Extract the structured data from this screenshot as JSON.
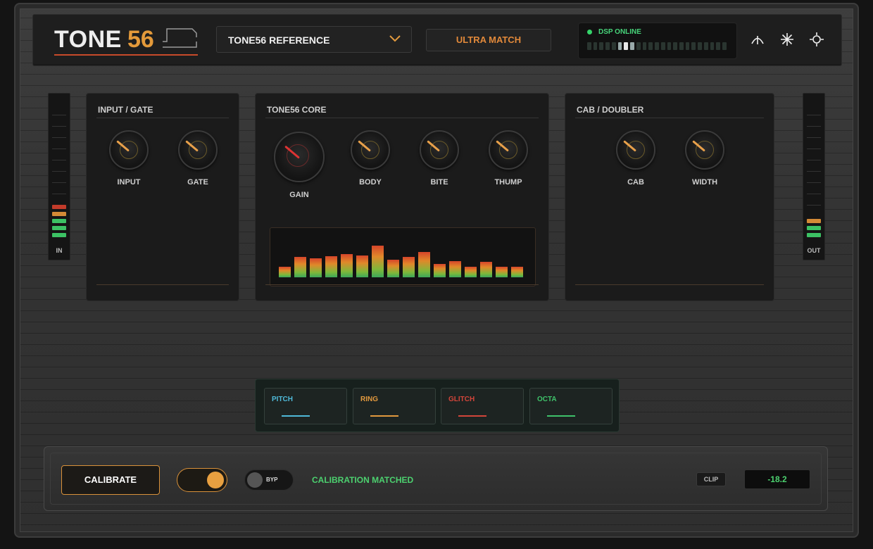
{
  "header": {
    "logo_word": "TONE",
    "logo_number": "56",
    "preset_name": "TONE56 REFERENCE",
    "mode_button": "ULTRA MATCH",
    "dsp_status": "DSP ONLINE",
    "icons": [
      "antenna-icon",
      "snowflake-icon",
      "target-icon"
    ]
  },
  "meters": {
    "in_label": "IN",
    "out_label": "OUT"
  },
  "panels": {
    "input_gate": {
      "title": "INPUT / GATE",
      "knobs": [
        {
          "label": "INPUT"
        },
        {
          "label": "GATE"
        }
      ]
    },
    "core": {
      "title": "TONE56 CORE",
      "knobs": [
        {
          "label": "GAIN"
        },
        {
          "label": "BODY"
        },
        {
          "label": "BITE"
        },
        {
          "label": "THUMP"
        }
      ],
      "spectrum_levels": [
        0.22,
        0.42,
        0.38,
        0.43,
        0.47,
        0.44,
        0.64,
        0.35,
        0.42,
        0.52,
        0.27,
        0.33,
        0.22,
        0.32,
        0.22,
        0.22
      ]
    },
    "cab": {
      "title": "CAB / DOUBLER",
      "knobs": [
        {
          "label": "CAB"
        },
        {
          "label": "WIDTH"
        }
      ]
    }
  },
  "fx": [
    {
      "label": "PITCH",
      "color": "#4fb9d8"
    },
    {
      "label": "RING",
      "color": "#e2993e"
    },
    {
      "label": "GLITCH",
      "color": "#d2453a"
    },
    {
      "label": "OCTA",
      "color": "#3fc26a"
    }
  ],
  "footer": {
    "calibrate_label": "CALIBRATE",
    "bypass_label": "BYP",
    "status_text": "CALIBRATION MATCHED",
    "clip_label": "CLIP",
    "readout_value": "-18.2"
  },
  "colors": {
    "accent": "#e49a3a",
    "status_green": "#4cd16f",
    "warning_red": "#c84a2a"
  }
}
